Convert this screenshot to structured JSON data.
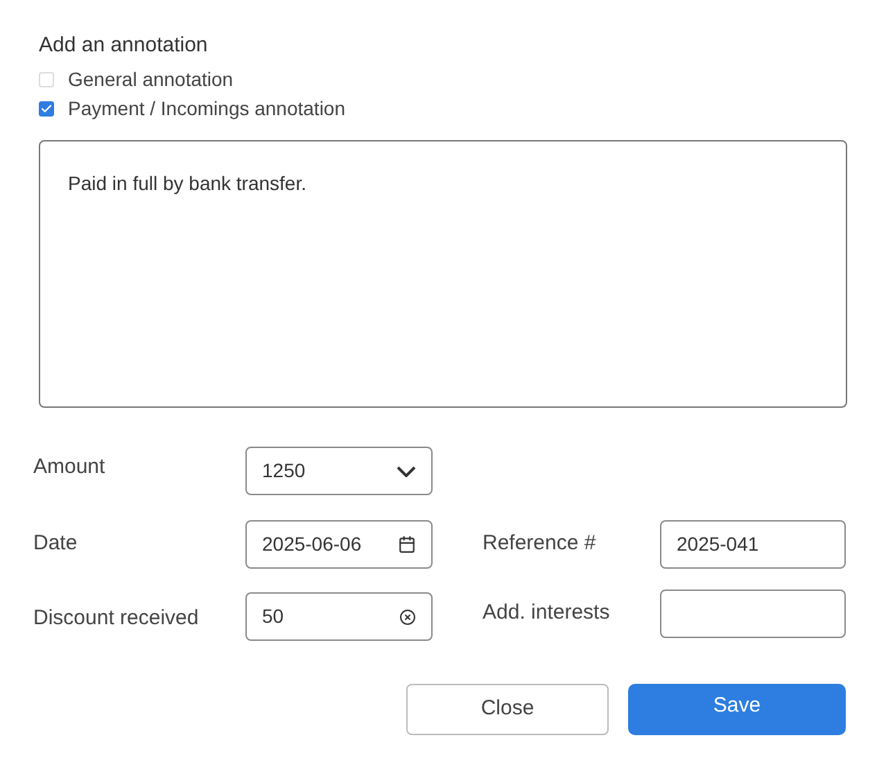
{
  "title": "Add an annotation",
  "annotation_types": [
    {
      "label": "General annotation",
      "checked": false
    },
    {
      "label": "Payment / Incomings annotation",
      "checked": true
    }
  ],
  "note": {
    "value": "Paid in full by bank transfer."
  },
  "amount": {
    "label": "Amount",
    "value": "1250"
  },
  "date": {
    "label": "Date",
    "value": "2025-06-06"
  },
  "reference": {
    "label": "Reference #",
    "value": "2025-041"
  },
  "discount": {
    "label": "Discount received",
    "value": "50"
  },
  "interests": {
    "label": "Add. interests"
  },
  "buttons": {
    "close": "Close",
    "save": "Save"
  }
}
